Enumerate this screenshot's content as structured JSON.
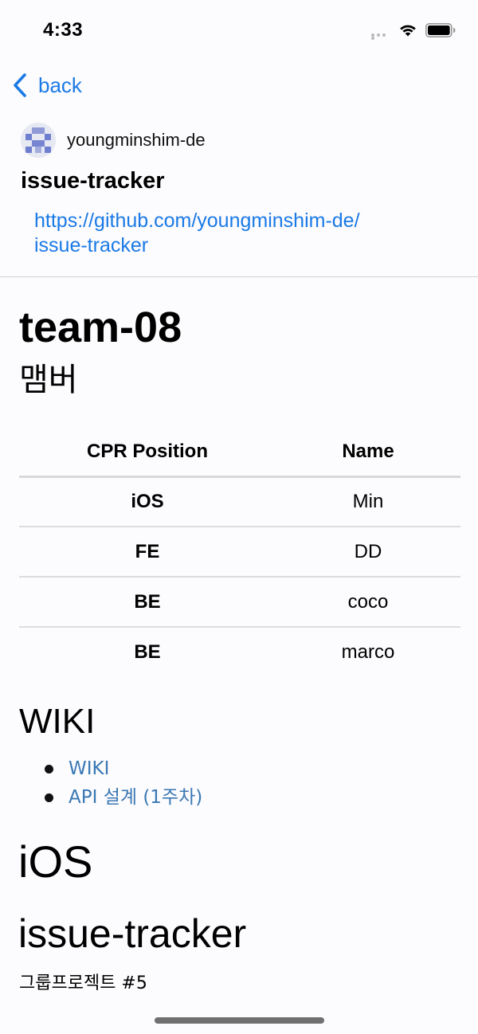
{
  "status_bar": {
    "time": "4:33"
  },
  "nav": {
    "back_label": "back"
  },
  "repo": {
    "owner": "youngminshim-de",
    "name": "issue-tracker",
    "url_line1": "https://github.com/youngminshim-de/",
    "url_line2": "issue-tracker"
  },
  "readme": {
    "title": "team-08",
    "members_heading": "맴버",
    "table": {
      "headers": [
        "CPR Position",
        "Name"
      ],
      "rows": [
        {
          "position": "iOS",
          "name": "Min"
        },
        {
          "position": "FE",
          "name": "DD"
        },
        {
          "position": "BE",
          "name": "coco"
        },
        {
          "position": "BE",
          "name": "marco"
        }
      ]
    },
    "wiki_heading": "WIKI",
    "wiki_links": [
      "WIKI",
      "API 설계 (1주차)"
    ],
    "ios_heading": "iOS",
    "project_heading": "issue-tracker",
    "group_text": "그룹프로젝트 #5"
  },
  "colors": {
    "link": "#1a7ae6",
    "readme_link": "#3a78b4",
    "background": "#fcfbfd"
  }
}
